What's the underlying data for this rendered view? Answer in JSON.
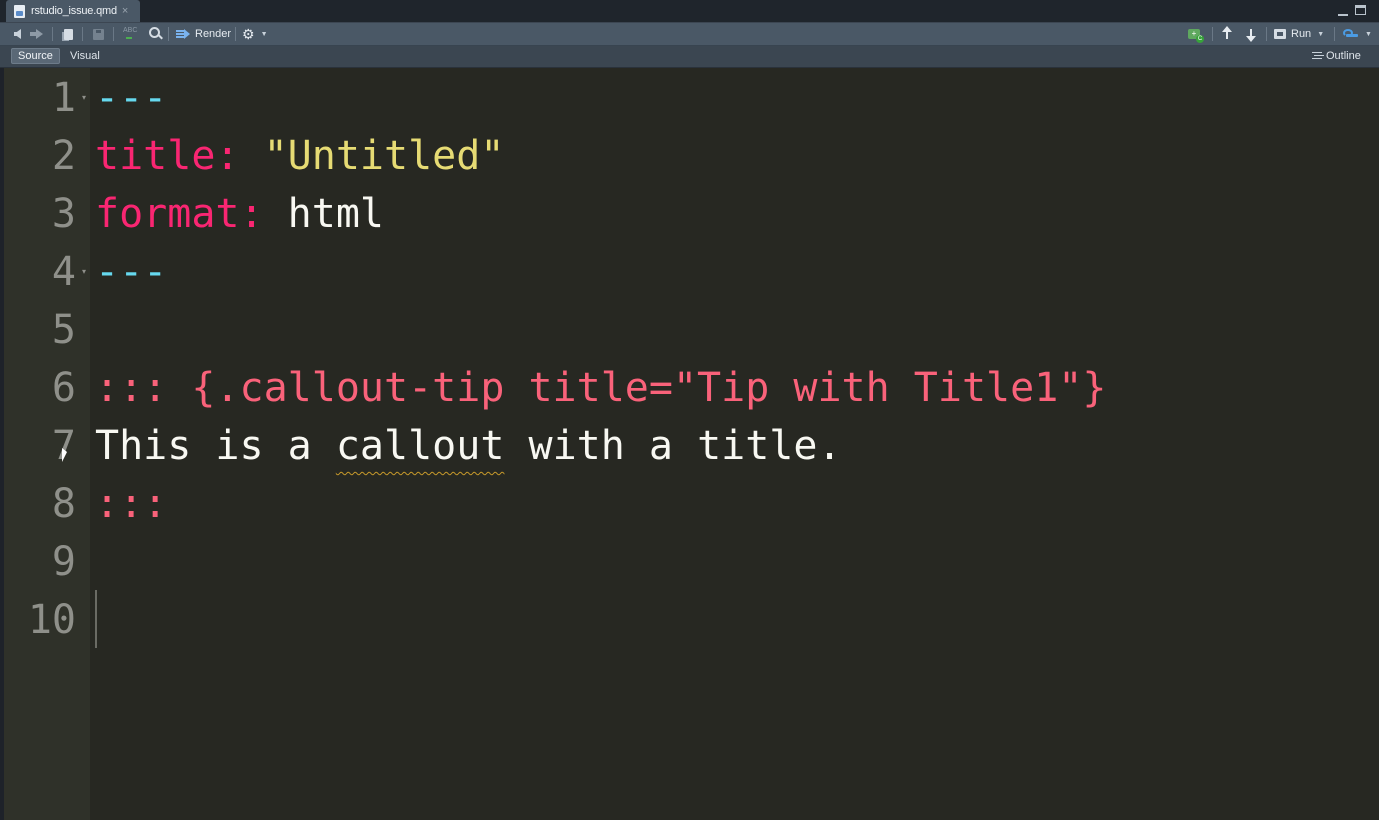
{
  "tab": {
    "filename": "rstudio_issue.qmd",
    "close": "×"
  },
  "toolbar": {
    "render_label": "Render",
    "run_label": "Run"
  },
  "modes": {
    "source": "Source",
    "visual": "Visual",
    "outline": "Outline"
  },
  "editor": {
    "lines": [
      {
        "num": "1",
        "parts": [
          {
            "t": "---",
            "c": "dash"
          }
        ]
      },
      {
        "num": "2",
        "parts": [
          {
            "t": "title: ",
            "c": "key"
          },
          {
            "t": "\"Untitled\"",
            "c": "str"
          }
        ]
      },
      {
        "num": "3",
        "parts": [
          {
            "t": "format: ",
            "c": "key"
          },
          {
            "t": "html",
            "c": ""
          }
        ]
      },
      {
        "num": "4",
        "parts": [
          {
            "t": "---",
            "c": "dash"
          }
        ]
      },
      {
        "num": "5",
        "parts": []
      },
      {
        "num": "6",
        "parts": [
          {
            "t": "::: {.callout-tip title=\"Tip with Title1\"}",
            "c": "div"
          }
        ]
      },
      {
        "num": "7",
        "parts": [
          {
            "t": "This is a ",
            "c": ""
          },
          {
            "t": "callout",
            "c": "spell"
          },
          {
            "t": " with a title.",
            "c": ""
          }
        ]
      },
      {
        "num": "8",
        "parts": [
          {
            "t": ":::",
            "c": "div"
          }
        ]
      },
      {
        "num": "9",
        "parts": []
      },
      {
        "num": "10",
        "parts": []
      }
    ]
  },
  "colors": {
    "editor_bg": "#272822",
    "dash": "#66d9ef",
    "key": "#f92672",
    "string": "#e6db74",
    "div": "#f9627a",
    "text": "#f8f8f2"
  }
}
